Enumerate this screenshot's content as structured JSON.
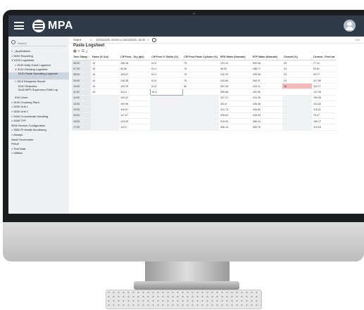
{
  "app": {
    "logo_text": "MPA"
  },
  "sidebar": {
    "search_placeholder": "Search",
    "items": [
      {
        "label": "> _Applications",
        "indent": 0,
        "selected": false
      },
      {
        "label": "> 5000 Reporting",
        "indent": 0,
        "selected": false
      },
      {
        "label": "∨ 5100 Logsheets",
        "indent": 0,
        "selected": false
      },
      {
        "label": "> 5100 Daily Grind Logsheet",
        "indent": 1,
        "selected": false
      },
      {
        "label": "∨ 5110 Grinding Logsheet",
        "indent": 1,
        "selected": false
      },
      {
        "label": "5110 Paste Operating Logsheet",
        "indent": 2,
        "selected": true
      },
      {
        "label": "> 5110 Reagents Report",
        "indent": 1,
        "selected": false
      },
      {
        "label": "5110 Setpoints",
        "indent": 2,
        "selected": false
      },
      {
        "label": "5140 MPS Supervisor Shift Log",
        "indent": 2,
        "selected": false
      },
      {
        "label": "5111 More",
        "indent": 1,
        "selected": false
      },
      {
        "label": "> 5100 Crushing Plant",
        "indent": 0,
        "selected": false
      },
      {
        "label": "> 5230 Unit 1",
        "indent": 0,
        "selected": false
      },
      {
        "label": "> 5240 Unit 2",
        "indent": 0,
        "selected": false
      },
      {
        "label": "> 5340 Concentrate Handling",
        "indent": 0,
        "selected": false
      },
      {
        "label": "> 5345 TPF",
        "indent": 0,
        "selected": false
      },
      {
        "label": "9000 Service Configuration",
        "indent": 0,
        "selected": false
      },
      {
        "label": "> 9500 PI Health Monitoring",
        "indent": 0,
        "selected": false
      },
      {
        "label": "> Assays",
        "indent": 0,
        "selected": false
      },
      {
        "label": "Asset Scorecards",
        "indent": 0,
        "selected": false
      },
      {
        "label": "PiSoft",
        "indent": 0,
        "selected": false
      },
      {
        "label": "> Test Data",
        "indent": 0,
        "selected": false
      },
      {
        "label": "> Utilities",
        "indent": 0,
        "selected": false
      }
    ]
  },
  "toolbar": {
    "shift_label": "Shift",
    "shift_arrow": "▾",
    "prev_label": "<",
    "date_range": "10/03/2020, 06:00 to 10/03/2020, 18:00",
    "next_label": ">",
    "clock_icon": "clock-icon",
    "right_text": "Hdr"
  },
  "page": {
    "title": "Paste Logsheet",
    "view_icons": [
      "grid-view-icon",
      "filter-icon",
      "list-view-icon",
      "download-icon"
    ]
  },
  "table": {
    "columns": [
      "Time Stamp ↑",
      "Paste (% Sol)",
      "CIP Feed - Dry (tph)",
      "CIP Feed % Solids (%)",
      "CIP Feed Paste Cylinder (%)",
      "RFD Water (flowrate)",
      "RTP Water (flowrate)",
      "Cement (%)",
      "Cement - Feed rat"
    ],
    "rows": [
      [
        "06:00",
        "14",
        "156.16",
        "51.5",
        "75",
        "123.15",
        "592.08",
        "25",
        "77.41"
      ],
      [
        "07:00",
        "15",
        "93.56",
        "51.2",
        "75",
        "98.32",
        "288.77",
        "24",
        "92.81"
      ],
      [
        "08:00",
        "14",
        "163.47",
        "51.2",
        "75",
        "132.33",
        "339.38",
        "24",
        "94.77"
      ],
      [
        "09:00",
        "14",
        "128.38",
        "51.5",
        "75",
        "245.84",
        "360.37",
        "20",
        "117.69"
      ],
      [
        "10:00",
        "15",
        "120.29",
        "51.5",
        "80",
        "287.35",
        "423.11",
        "18",
        "110.77"
      ],
      [
        "11:00",
        "15",
        "114.4",
        "51.6",
        "",
        "359.65",
        "451.50",
        "",
        "137.05"
      ],
      [
        "12:00",
        "",
        "115.22",
        "",
        "",
        "347.21",
        "410.39",
        "",
        "154.35"
      ],
      [
        "13:00",
        "",
        "109.06",
        "",
        "",
        "301.8",
        "436.38",
        "",
        "151.63"
      ],
      [
        "14:00",
        "",
        "116.97",
        "",
        "",
        "312.73",
        "434.84",
        "",
        "118.21"
      ],
      [
        "15:00",
        "",
        "117.07",
        "",
        "",
        "328.64",
        "449.43",
        "",
        "75.27"
      ],
      [
        "16:00",
        "",
        "124.05",
        "",
        "",
        "319.93",
        "456.44",
        "",
        "155.17"
      ],
      [
        "17:00",
        "",
        "119.1",
        "",
        "",
        "356.15",
        "383.76",
        "",
        "119.16"
      ]
    ],
    "alert_cell": {
      "row": 4,
      "col": 7
    },
    "edit_cell": {
      "row": 5,
      "col": 3
    }
  }
}
